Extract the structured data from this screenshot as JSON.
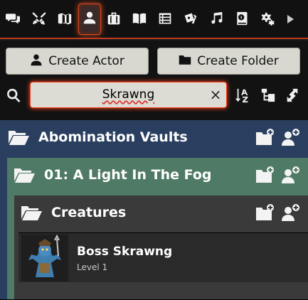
{
  "tabs": [
    {
      "name": "chat-icon"
    },
    {
      "name": "combat-swords-icon"
    },
    {
      "name": "map-icon"
    },
    {
      "name": "actor-user-icon",
      "active": true
    },
    {
      "name": "items-suitcase-icon"
    },
    {
      "name": "journal-book-icon"
    },
    {
      "name": "tables-list-icon"
    },
    {
      "name": "cards-icon"
    },
    {
      "name": "music-icon"
    },
    {
      "name": "compendium-globe-book-icon"
    },
    {
      "name": "settings-gears-icon"
    },
    {
      "name": "expand-arrow-icon"
    }
  ],
  "actions": {
    "create_actor": "Create Actor",
    "create_folder": "Create Folder"
  },
  "search": {
    "value": "Skrawng",
    "clear": "×"
  },
  "tree": {
    "level1": {
      "name": "Abomination Vaults",
      "color": "#2a3f60"
    },
    "level2": {
      "name": "01: A Light In The Fog",
      "color": "#4f7a66"
    },
    "level3": {
      "name": "Creatures",
      "color": "#3a3a3a"
    },
    "actor": {
      "name": "Boss Skrawng",
      "level": "Level 1"
    }
  },
  "colors": {
    "accent": "#d04a20",
    "search_glow": "#ff3b1a"
  }
}
